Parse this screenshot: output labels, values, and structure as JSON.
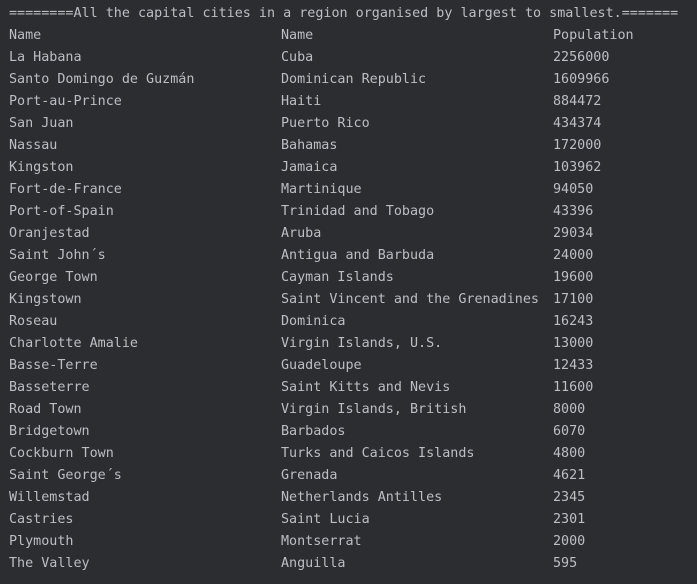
{
  "banner": "========All the capital cities in a region organised by largest to smallest.=======",
  "headers": [
    "Name",
    "Name",
    "Population"
  ],
  "rows": [
    [
      "La Habana",
      "Cuba",
      "2256000"
    ],
    [
      "Santo Domingo de Guzmán",
      "Dominican Republic",
      "1609966"
    ],
    [
      "Port-au-Prince",
      "Haiti",
      "884472"
    ],
    [
      "San Juan",
      "Puerto Rico",
      "434374"
    ],
    [
      "Nassau",
      "Bahamas",
      "172000"
    ],
    [
      "Kingston",
      "Jamaica",
      "103962"
    ],
    [
      "Fort-de-France",
      "Martinique",
      "94050"
    ],
    [
      "Port-of-Spain",
      "Trinidad and Tobago",
      "43396"
    ],
    [
      "Oranjestad",
      "Aruba",
      "29034"
    ],
    [
      "Saint John´s",
      "Antigua and Barbuda",
      "24000"
    ],
    [
      "George Town",
      "Cayman Islands",
      "19600"
    ],
    [
      "Kingstown",
      "Saint Vincent and the Grenadines",
      "17100"
    ],
    [
      "Roseau",
      "Dominica",
      "16243"
    ],
    [
      "Charlotte Amalie",
      "Virgin Islands, U.S.",
      "13000"
    ],
    [
      "Basse-Terre",
      "Guadeloupe",
      "12433"
    ],
    [
      "Basseterre",
      "Saint Kitts and Nevis",
      "11600"
    ],
    [
      "Road Town",
      "Virgin Islands, British",
      "8000"
    ],
    [
      "Bridgetown",
      "Barbados",
      "6070"
    ],
    [
      "Cockburn Town",
      "Turks and Caicos Islands",
      "4800"
    ],
    [
      "Saint George´s",
      "Grenada",
      "4621"
    ],
    [
      "Willemstad",
      "Netherlands Antilles",
      "2345"
    ],
    [
      "Castries",
      "Saint Lucia",
      "2301"
    ],
    [
      "Plymouth",
      "Montserrat",
      "2000"
    ],
    [
      "The Valley",
      "Anguilla",
      "595"
    ]
  ],
  "colors": {
    "background": "#2b2d30",
    "text": "#bcbec4"
  }
}
